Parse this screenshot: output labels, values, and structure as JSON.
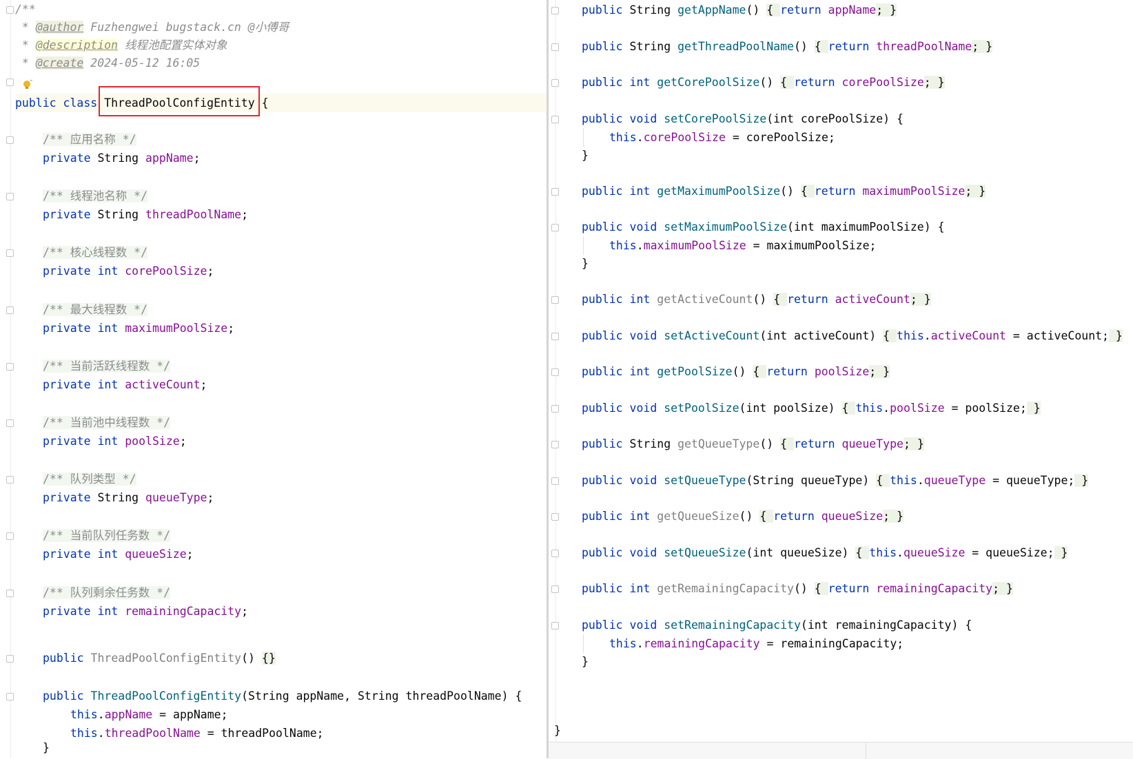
{
  "left_editor": {
    "javadoc": {
      "open": "/**",
      "author_prefix": " * ",
      "author_tag": "@author",
      "author_value": " Fuzhengwei bugstack.cn @小傅哥",
      "description_prefix": " * ",
      "description_tag": "@description",
      "description_value": " 线程池配置实体对象",
      "create_prefix": " * ",
      "create_tag": "@create",
      "create_value": " 2024-05-12 16:05",
      "close": " */"
    },
    "class_decl": {
      "public_kw": "public",
      "class_kw": "class",
      "class_name": "ThreadPoolConfigEntity",
      "brace": "{"
    },
    "fields": [
      {
        "comment": "/** 应用名称 */",
        "type": "String",
        "name": "appName"
      },
      {
        "comment": "/** 线程池名称 */",
        "type": "String",
        "name": "threadPoolName"
      },
      {
        "comment": "/** 核心线程数 */",
        "type": "int",
        "name": "corePoolSize"
      },
      {
        "comment": "/** 最大线程数 */",
        "type": "int",
        "name": "maximumPoolSize"
      },
      {
        "comment": "/** 当前活跃线程数 */",
        "type": "int",
        "name": "activeCount"
      },
      {
        "comment": "/** 当前池中线程数 */",
        "type": "int",
        "name": "poolSize"
      },
      {
        "comment": "/** 队列类型 */",
        "type": "String",
        "name": "queueType"
      },
      {
        "comment": "/** 当前队列任务数 */",
        "type": "int",
        "name": "queueSize"
      },
      {
        "comment": "/** 队列剩余任务数 */",
        "type": "int",
        "name": "remainingCapacity"
      }
    ],
    "private_kw": "private",
    "semicolon": ";",
    "ctor1": {
      "public_kw": "public",
      "name": "ThreadPoolConfigEntity",
      "parens": "()",
      "body": "{}"
    },
    "ctor2": {
      "public_kw": "public",
      "name": "ThreadPoolConfigEntity",
      "params": "(String appName, String threadPoolName) {",
      "line1_this": "this",
      "line1_field": "appName",
      "line1_rest": " = appName;",
      "line2_this": "this",
      "line2_field": "threadPoolName",
      "line2_rest": " = threadPoolName;",
      "close": "}"
    }
  },
  "right_editor": {
    "methods": [
      {
        "mod": "public",
        "ret": "String",
        "name": "getAppName",
        "sig": "()",
        "body_kw": "return",
        "body_field": "appName",
        "style": "get"
      },
      {
        "mod": "public",
        "ret": "String",
        "name": "getThreadPoolName",
        "sig": "()",
        "body_kw": "return",
        "body_field": "threadPoolName",
        "style": "get"
      },
      {
        "mod": "public",
        "ret": "int",
        "name": "getCorePoolSize",
        "sig": "()",
        "body_kw": "return",
        "body_field": "corePoolSize",
        "style": "get"
      },
      {
        "mod": "public",
        "ret": "void",
        "name": "setCorePoolSize",
        "sig": "(int corePoolSize) {",
        "body_kw": "this",
        "body_field": "corePoolSize",
        "body_rest": " = corePoolSize;",
        "style": "set-block"
      },
      {
        "mod": "public",
        "ret": "int",
        "name": "getMaximumPoolSize",
        "sig": "()",
        "body_kw": "return",
        "body_field": "maximumPoolSize",
        "style": "get"
      },
      {
        "mod": "public",
        "ret": "void",
        "name": "setMaximumPoolSize",
        "sig": "(int maximumPoolSize) {",
        "body_kw": "this",
        "body_field": "maximumPoolSize",
        "body_rest": " = maximumPoolSize;",
        "style": "set-block"
      },
      {
        "mod": "public",
        "ret": "int",
        "name": "getActiveCount",
        "sig": "()",
        "body_kw": "return",
        "body_field": "activeCount",
        "style": "get-unused"
      },
      {
        "mod": "public",
        "ret": "void",
        "name": "setActiveCount",
        "sig": "(int activeCount)",
        "body_kw": "this",
        "body_field": "activeCount",
        "body_rest": " = activeCount;",
        "style": "set-inline"
      },
      {
        "mod": "public",
        "ret": "int",
        "name": "getPoolSize",
        "sig": "()",
        "body_kw": "return",
        "body_field": "poolSize",
        "style": "get"
      },
      {
        "mod": "public",
        "ret": "void",
        "name": "setPoolSize",
        "sig": "(int poolSize)",
        "body_kw": "this",
        "body_field": "poolSize",
        "body_rest": " = poolSize;",
        "style": "set-inline"
      },
      {
        "mod": "public",
        "ret": "String",
        "name": "getQueueType",
        "sig": "()",
        "body_kw": "return",
        "body_field": "queueType",
        "style": "get-unused"
      },
      {
        "mod": "public",
        "ret": "void",
        "name": "setQueueType",
        "sig": "(String queueType)",
        "body_kw": "this",
        "body_field": "queueType",
        "body_rest": " = queueType;",
        "style": "set-inline"
      },
      {
        "mod": "public",
        "ret": "int",
        "name": "getQueueSize",
        "sig": "()",
        "body_kw": "return",
        "body_field": "queueSize",
        "style": "get-unused"
      },
      {
        "mod": "public",
        "ret": "void",
        "name": "setQueueSize",
        "sig": "(int queueSize)",
        "body_kw": "this",
        "body_field": "queueSize",
        "body_rest": " = queueSize;",
        "style": "set-inline"
      },
      {
        "mod": "public",
        "ret": "int",
        "name": "getRemainingCapacity",
        "sig": "()",
        "body_kw": "return",
        "body_field": "remainingCapacity",
        "style": "get-unused"
      },
      {
        "mod": "public",
        "ret": "void",
        "name": "setRemainingCapacity",
        "sig": "(int remainingCapacity) {",
        "body_kw": "this",
        "body_field": "remainingCapacity",
        "body_rest": " = remainingCapacity;",
        "style": "set-block"
      }
    ],
    "close_brace": "}",
    "class_close": "}"
  },
  "colors": {
    "keyword": "#0033b3",
    "field": "#871094",
    "method": "#00627a",
    "comment": "#8c8c8c",
    "highlight_box": "#e6262e"
  }
}
